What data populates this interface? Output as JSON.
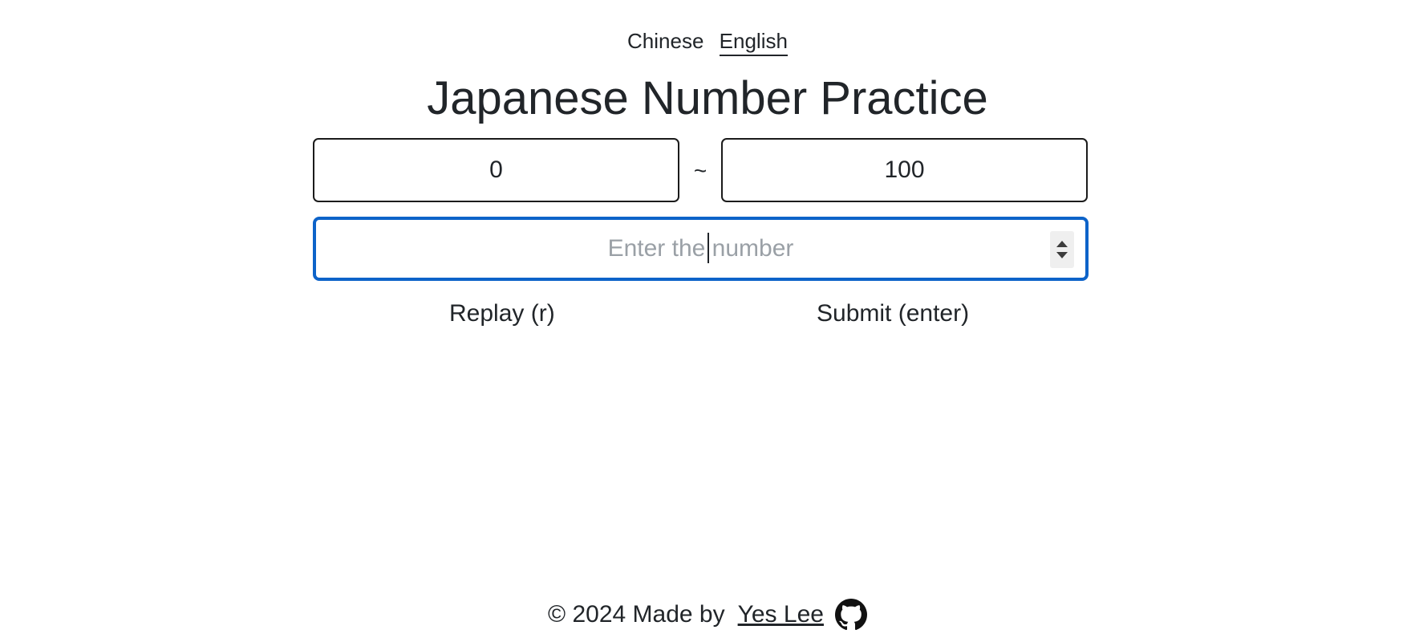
{
  "language_switch": {
    "items": [
      {
        "label": "Chinese",
        "active": false
      },
      {
        "label": "English",
        "active": true
      }
    ]
  },
  "title": "Japanese Number Practice",
  "range": {
    "min_value": "0",
    "separator": "~",
    "max_value": "100"
  },
  "answer_input": {
    "placeholder": "Enter the number",
    "value": "",
    "focused_border_color": "#0d63c9",
    "spinner_icons": [
      "spin-up-icon",
      "spin-down-icon"
    ]
  },
  "actions": {
    "replay_label": "Replay (r)",
    "submit_label": "Submit (enter)"
  },
  "footer": {
    "copyright": "© 2024 Made by",
    "author_link": "Yes Lee",
    "icon": "github-icon"
  }
}
